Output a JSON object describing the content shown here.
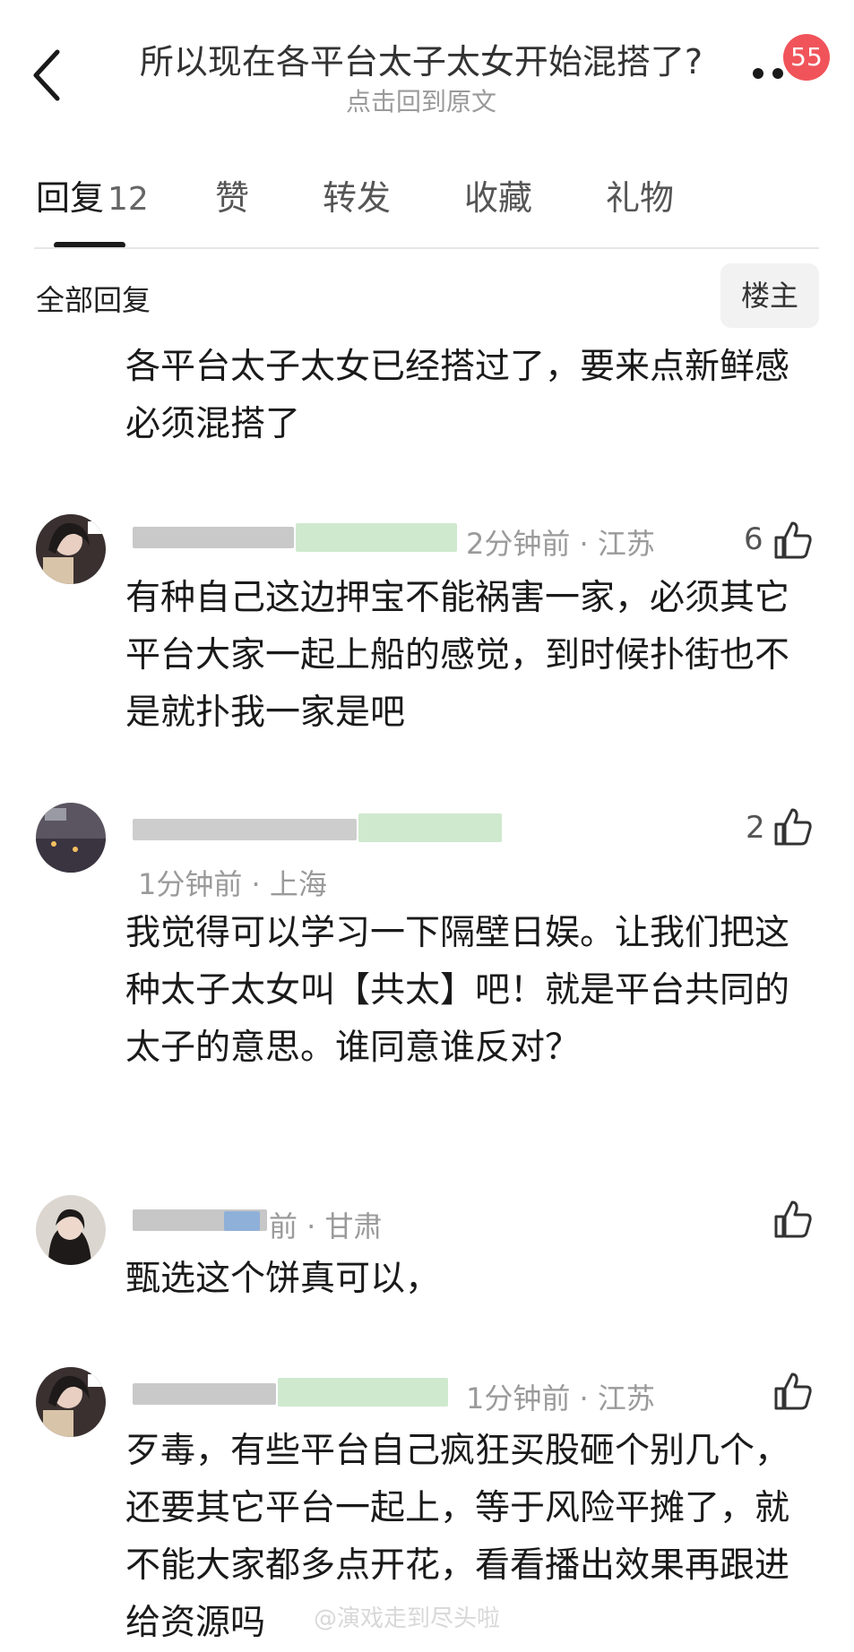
{
  "header": {
    "title": "所以现在各平台太子太女开始混搭了?",
    "subtitle": "点击回到原文",
    "badge": "55"
  },
  "tabs": [
    {
      "label": "回复",
      "count": "12"
    },
    {
      "label": "赞"
    },
    {
      "label": "转发"
    },
    {
      "label": "收藏"
    },
    {
      "label": "礼物"
    }
  ],
  "filter": {
    "all_replies": "全部回复",
    "op_only": "楼主"
  },
  "comments": [
    {
      "text": "各平台太子太女已经搭过了，要来点新鲜感必须混搭了"
    },
    {
      "meta": "2分钟前 · 江苏",
      "likes": "6",
      "text": "有种自己这边押宝不能祸害一家，必须其它平台大家一起上船的感觉，到时候扑街也不是就扑我一家是吧"
    },
    {
      "meta": "1分钟前 · 上海",
      "likes": "2",
      "text": "我觉得可以学习一下隔壁日娱。让我们把这种太子太女叫【共太】吧！就是平台共同的太子的意思。谁同意谁反对？"
    },
    {
      "meta": "前 · 甘肃",
      "likes": "",
      "text": "甄选这个饼真可以，"
    },
    {
      "meta": "1分钟前 · 江苏",
      "likes": "",
      "text": "歹毒，有些平台自己疯狂买股砸个别几个，还要其它平台一起上，等于风险平摊了，就不能大家都多点开花，看看播出效果再跟进给资源吗"
    }
  ],
  "watermark": "@演戏走到尽头啦",
  "colors": {
    "badge": "#f0545a",
    "text": "#1a1a1a",
    "meta": "#9a9a9a"
  }
}
